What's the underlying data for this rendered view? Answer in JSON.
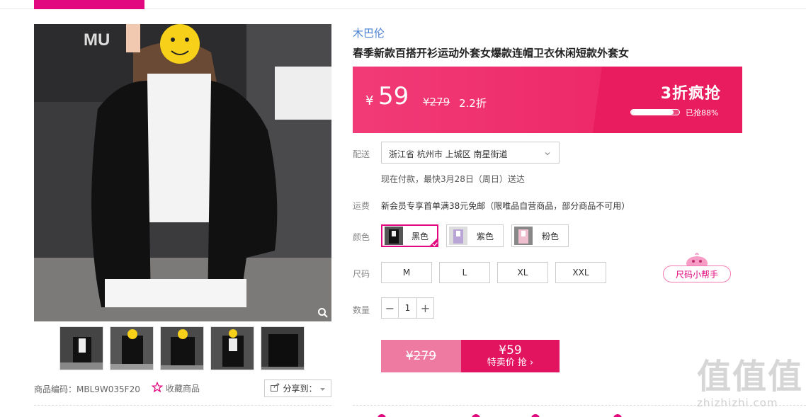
{
  "colors": {
    "accent": "#e2087f",
    "brand_link": "#4a7fd0",
    "banner": "#ee2a6a",
    "buy_dark": "#e2145f",
    "buy_light": "#ee7aa1"
  },
  "product": {
    "brand": "木巴伦",
    "title": "春季新款百搭开衫运动外套女爆款连帽卫衣休闲短款外套女",
    "code_label": "商品编码：MBL9W035F20",
    "favorite_label": "收藏商品",
    "share_label": "分享到："
  },
  "price_banner": {
    "currency": "¥",
    "price": "59",
    "original": "¥279",
    "discount": "2.2折",
    "promo_title": "3折疯抢",
    "sold_text": "已抢88%",
    "sold_percent": 88
  },
  "delivery": {
    "label": "配送",
    "address": "浙江省 杭州市 上城区 南星街道",
    "time_text": "现在付款，最快3月28日（周日）送达"
  },
  "shipping": {
    "label": "运费",
    "text": "新会员专享首单满38元免邮（限唯品自营商品，部分商品不可用）"
  },
  "color_section": {
    "label": "颜色",
    "options": [
      {
        "name": "黑色",
        "selected": true
      },
      {
        "name": "紫色",
        "selected": false
      },
      {
        "name": "粉色",
        "selected": false
      }
    ]
  },
  "size_section": {
    "label": "尺码",
    "options": [
      "M",
      "L",
      "XL",
      "XXL"
    ],
    "helper_label": "尺码小帮手"
  },
  "quantity": {
    "label": "数量",
    "value": "1",
    "minus": "−",
    "plus": "+"
  },
  "buy_button": {
    "original": "¥279",
    "price": "¥59",
    "action": "特卖价 抢 ›"
  },
  "watermark": {
    "big": "值值值",
    "small": "zhizhizhi.com"
  }
}
